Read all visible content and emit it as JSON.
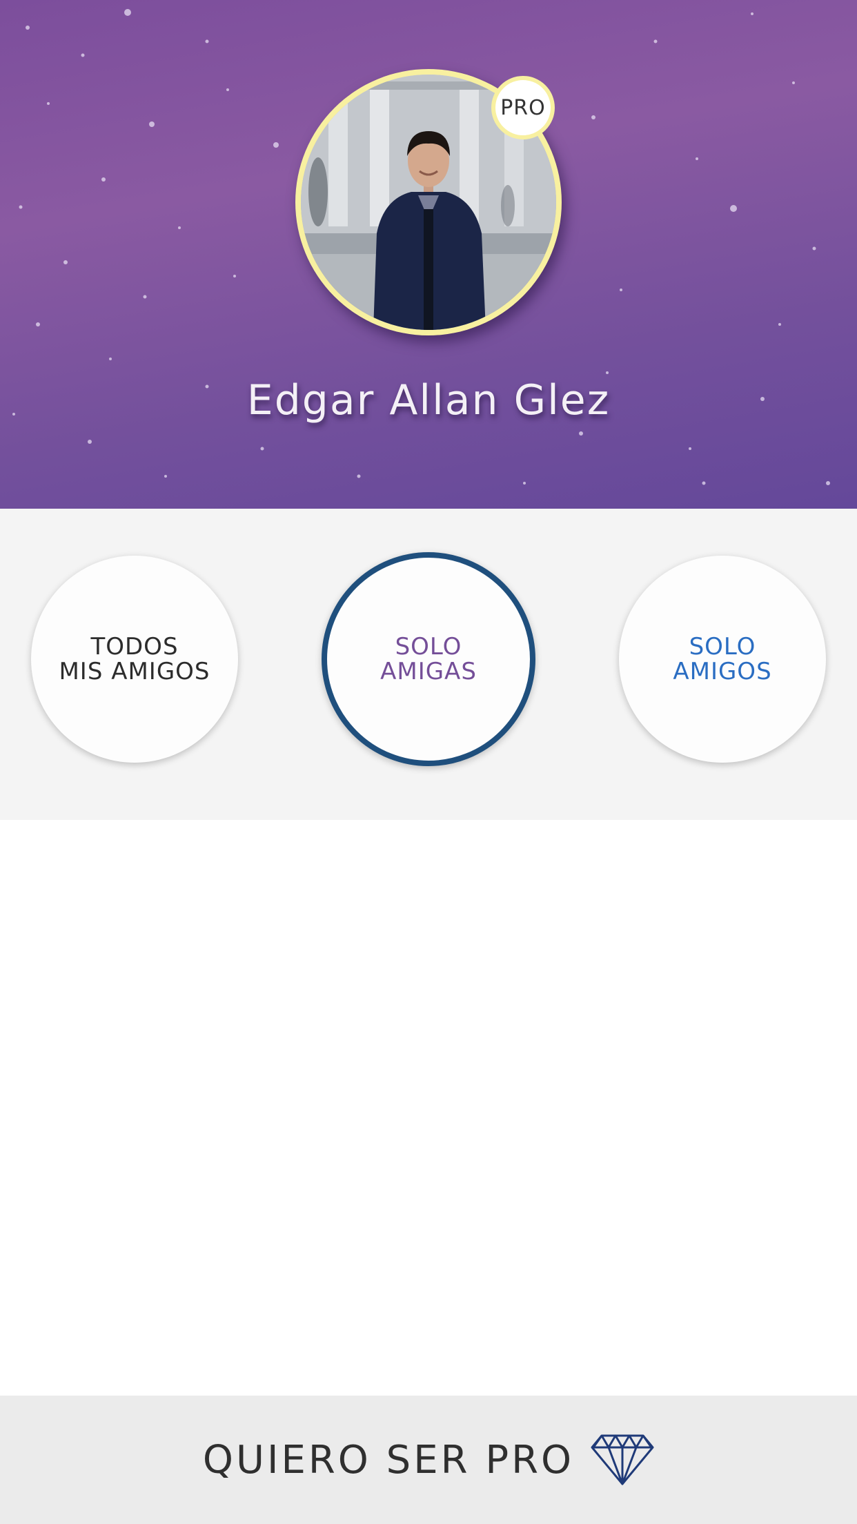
{
  "header": {
    "user_name": "Edgar Allan Glez",
    "badge_label": "PRO",
    "avatar_ring_color": "#f8f0a0",
    "background_colors": [
      "#8a5aa2",
      "#64489a"
    ]
  },
  "filters": {
    "all": {
      "line1": "TODOS",
      "line2": "MIS AMIGOS",
      "color": "#2c2c2c"
    },
    "girls": {
      "line1": "SOLO",
      "line2": "AMIGAS",
      "color": "#744e98",
      "selected": true,
      "ring_color": "#1f4f7d"
    },
    "boys": {
      "line1": "SOLO",
      "line2": "AMIGOS",
      "color": "#2a6dc2"
    }
  },
  "footer": {
    "label": "QUIERO SER PRO",
    "icon": "diamond-icon",
    "icon_color": "#1f3a78"
  }
}
